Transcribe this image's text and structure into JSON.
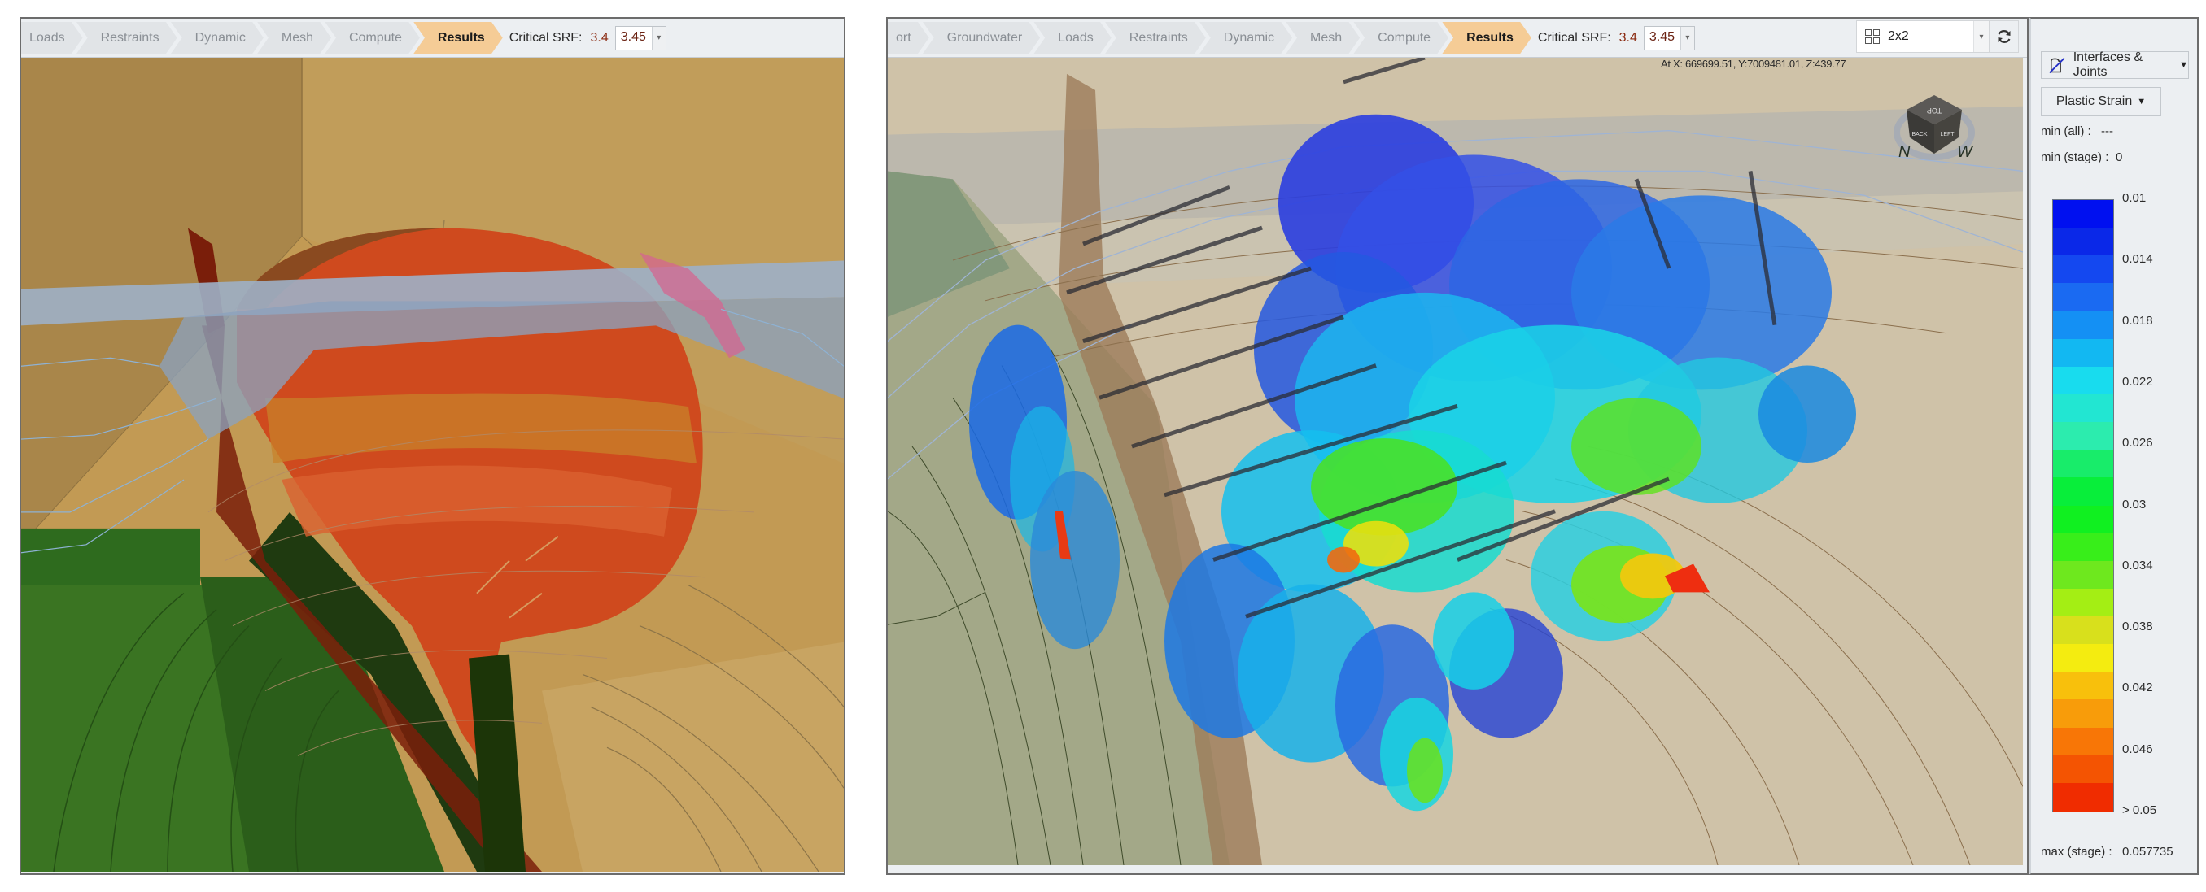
{
  "left_view": {
    "workflow_steps": [
      {
        "label": "Loads",
        "active": false
      },
      {
        "label": "Restraints",
        "active": false
      },
      {
        "label": "Dynamic",
        "active": false
      },
      {
        "label": "Mesh",
        "active": false
      },
      {
        "label": "Compute",
        "active": false
      },
      {
        "label": "Results",
        "active": true
      }
    ],
    "critical_srf_label": "Critical SRF:",
    "critical_srf_value": "3.4",
    "srf_selected": "3.45",
    "scene_description": "3D model view: orange plastic-zone shell over green and tan rock volumes with blue transparent horizon layer"
  },
  "right_view": {
    "workflow_steps": [
      {
        "label": "ort",
        "active": false
      },
      {
        "label": "Groundwater",
        "active": false
      },
      {
        "label": "Loads",
        "active": false
      },
      {
        "label": "Restraints",
        "active": false
      },
      {
        "label": "Dynamic",
        "active": false
      },
      {
        "label": "Mesh",
        "active": false
      },
      {
        "label": "Compute",
        "active": false
      },
      {
        "label": "Results",
        "active": true
      }
    ],
    "critical_srf_label": "Critical SRF:",
    "critical_srf_value": "3.4",
    "srf_selected": "3.45",
    "layout_selector": "2x2",
    "coordinate_readout": "At X: 669699.51, Y:7009481.01, Z:439.77",
    "view_cube": {
      "top": "TOP",
      "left": "BACK",
      "right": "LEFT",
      "compass_left": "N",
      "compass_right": "W"
    },
    "scene_description": "3D contour of plastic strain on interfaces & joints, blue to red"
  },
  "sidebar": {
    "interfaces_button": "Interfaces & Joints",
    "result_type_button": "Plastic Strain",
    "min_all_label": "min (all) :",
    "min_all_value": "---",
    "min_stage_label": "min (stage) :",
    "min_stage_value": "0",
    "max_stage_label": "max (stage) :",
    "max_stage_value": "0.057735",
    "legend": {
      "ticks": [
        "0.01",
        "0.014",
        "0.018",
        "0.022",
        "0.026",
        "0.03",
        "0.034",
        "0.038",
        "0.042",
        "0.046",
        "> 0.05"
      ],
      "colors": [
        "#0010f0",
        "#0a28e8",
        "#1448f0",
        "#1a6af2",
        "#1490f4",
        "#12b8f2",
        "#18dcee",
        "#22e6d2",
        "#2cecae",
        "#18ec6a",
        "#08ee3a",
        "#10f020",
        "#38ee1a",
        "#6ee81e",
        "#a4ee14",
        "#d8e01c",
        "#f4ec10",
        "#f8c00c",
        "#f89c0a",
        "#f87606",
        "#f45402",
        "#f02c00"
      ]
    }
  },
  "colors": {
    "active_step": "#f5cc96",
    "panel_bg": "#eceff2",
    "srf_value": "#8b2b12"
  }
}
